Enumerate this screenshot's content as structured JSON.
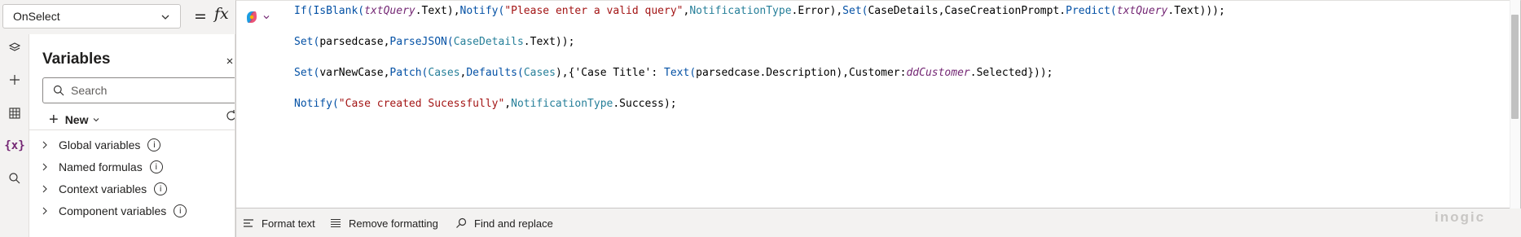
{
  "formula_bar": {
    "property": "OnSelect",
    "equals": "=",
    "fx": "fx"
  },
  "left_rail": {
    "icons": [
      "layers-icon",
      "plus-icon",
      "data-icon",
      "variables-icon",
      "search-icon"
    ],
    "variables_glyph": "{x}"
  },
  "variables_pane": {
    "title": "Variables",
    "search_placeholder": "Search",
    "new_label": "New",
    "sections": [
      {
        "label": "Global variables"
      },
      {
        "label": "Named formulas"
      },
      {
        "label": "Context variables"
      },
      {
        "label": "Component variables"
      }
    ]
  },
  "code_lines": [
    [
      {
        "t": "If(",
        "c": "fn"
      },
      {
        "t": "IsBlank(",
        "c": "fn"
      },
      {
        "t": "txtQuery",
        "c": "ctl"
      },
      {
        "t": ".Text)",
        "c": "txt"
      },
      {
        "t": ",",
        "c": "txt"
      },
      {
        "t": "Notify(",
        "c": "fn"
      },
      {
        "t": "\"Please enter a valid query\"",
        "c": "str"
      },
      {
        "t": ",",
        "c": "txt"
      },
      {
        "t": "NotificationType",
        "c": "enum"
      },
      {
        "t": ".Error)",
        "c": "txt"
      },
      {
        "t": ",",
        "c": "txt"
      },
      {
        "t": "Set(",
        "c": "fn"
      },
      {
        "t": "CaseDetails",
        "c": "txt"
      },
      {
        "t": ",",
        "c": "txt"
      },
      {
        "t": "CaseCreationPrompt",
        "c": "txt"
      },
      {
        "t": ".",
        "c": "txt"
      },
      {
        "t": "Predict(",
        "c": "fn"
      },
      {
        "t": "txtQuery",
        "c": "ctl"
      },
      {
        "t": ".Text)));",
        "c": "txt"
      }
    ],
    [
      {
        "t": "Set(",
        "c": "fn"
      },
      {
        "t": "parsedcase",
        "c": "txt"
      },
      {
        "t": ",",
        "c": "txt"
      },
      {
        "t": "ParseJSON(",
        "c": "fn"
      },
      {
        "t": "CaseDetails",
        "c": "enum"
      },
      {
        "t": ".Text));",
        "c": "txt"
      }
    ],
    [
      {
        "t": "Set(",
        "c": "fn"
      },
      {
        "t": "varNewCase",
        "c": "txt"
      },
      {
        "t": ",",
        "c": "txt"
      },
      {
        "t": "Patch(",
        "c": "fn"
      },
      {
        "t": "Cases",
        "c": "enum"
      },
      {
        "t": ",",
        "c": "txt"
      },
      {
        "t": "Defaults(",
        "c": "fn"
      },
      {
        "t": "Cases",
        "c": "enum"
      },
      {
        "t": "),{",
        "c": "txt"
      },
      {
        "t": "'Case Title'",
        "c": "txt"
      },
      {
        "t": ": ",
        "c": "txt"
      },
      {
        "t": "Text(",
        "c": "fn"
      },
      {
        "t": "parsedcase",
        "c": "txt"
      },
      {
        "t": ".Description),",
        "c": "txt"
      },
      {
        "t": "Customer",
        "c": "txt"
      },
      {
        "t": ":",
        "c": "txt"
      },
      {
        "t": "ddCustomer",
        "c": "ctl"
      },
      {
        "t": ".Selected}));",
        "c": "txt"
      }
    ],
    [
      {
        "t": "Notify(",
        "c": "fn"
      },
      {
        "t": "\"Case created Sucessfully\"",
        "c": "str"
      },
      {
        "t": ",",
        "c": "txt"
      },
      {
        "t": "NotificationType",
        "c": "enum"
      },
      {
        "t": ".Success);",
        "c": "txt"
      }
    ]
  ],
  "toolbar": {
    "format_text": "Format text",
    "remove_formatting": "Remove formatting",
    "find_replace": "Find and replace"
  },
  "brand": "inogic",
  "colors": {
    "function": "#0451a5",
    "string": "#a31515",
    "control": "#742774",
    "enum": "#267f99"
  }
}
